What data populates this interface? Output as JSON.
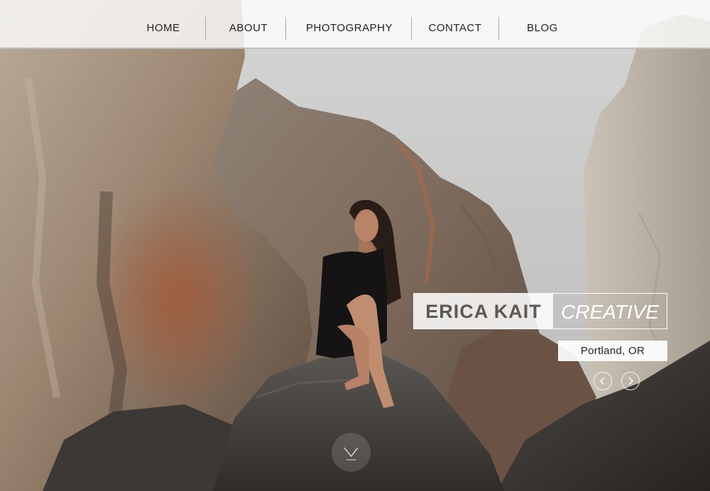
{
  "nav": {
    "items": [
      {
        "label": "HOME"
      },
      {
        "label": "ABOUT"
      },
      {
        "label": "PHOTOGRAPHY"
      },
      {
        "label": "CONTACT"
      },
      {
        "label": "BLOG"
      }
    ]
  },
  "hero": {
    "name": "ERICA KAIT",
    "role": "CREATIVE",
    "location": "Portland, OR",
    "prev_icon": "chevron-left-icon",
    "next_icon": "chevron-right-icon",
    "scroll_icon": "chevron-down-icon"
  },
  "colors": {
    "nav_bg": "#ffffff",
    "nav_text": "#222222",
    "name_text": "#5b5856",
    "accent_white": "#ffffff"
  }
}
